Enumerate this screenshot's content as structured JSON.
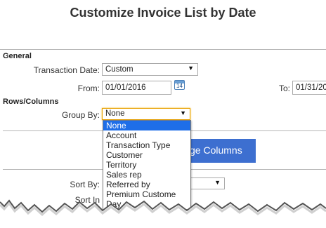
{
  "title": "Customize Invoice List by Date",
  "general": {
    "heading": "General",
    "transaction_date_label": "Transaction Date:",
    "transaction_date_value": "Custom",
    "from_label": "From:",
    "from_value": "01/01/2016",
    "calendar_day": "14",
    "to_label": "To:",
    "to_value": "01/31/20"
  },
  "rows_columns": {
    "heading": "Rows/Columns",
    "group_by_label": "Group By:",
    "group_by_value": "None",
    "change_columns_label": "ge Columns",
    "options": [
      "None",
      "Account",
      "Transaction Type",
      "Customer",
      "Territory",
      "Sales rep",
      "Referred by",
      "Premium Custome",
      "Day"
    ]
  },
  "sort": {
    "sort_by_label": "Sort By:",
    "sort_in_label": "Sort In"
  },
  "colors": {
    "accent": "#3d6fd0",
    "selection": "#1e6ee8",
    "focus": "#e8a000"
  }
}
